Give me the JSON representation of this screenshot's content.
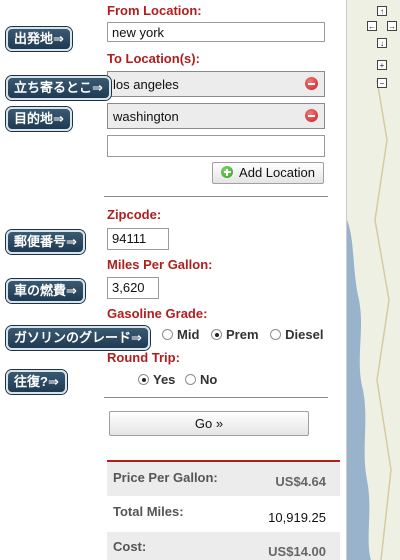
{
  "form": {
    "from_label": "From Location:",
    "from_value": "new york",
    "to_label": "To Location(s):",
    "to_values": [
      "los angeles",
      "washington"
    ],
    "add_location_label": "Add Location",
    "zip_label": "Zipcode:",
    "zip_value": "94111",
    "mpg_label": "Miles Per Gallon:",
    "mpg_value": "3,620",
    "grade_label": "Gasoline Grade:",
    "grade_options": [
      "Mid",
      "Prem",
      "Diesel"
    ],
    "grade_selected": "Prem",
    "round_trip_label": "Round Trip:",
    "round_trip_options": [
      "Yes",
      "No"
    ],
    "round_trip_selected": "Yes",
    "go_label": "Go »"
  },
  "results": {
    "price_label": "Price Per Gallon:",
    "price_value": "US$4.64",
    "miles_label": "Total Miles:",
    "miles_value": "10,919.25",
    "cost_label": "Cost:",
    "cost_value": "US$14.00"
  },
  "annotations": {
    "departure": "出発地⇒",
    "stopover": "立ち寄るとこ⇒",
    "destination": "目的地⇒",
    "postal_code": "郵便番号⇒",
    "fuel_economy": "車の燃費⇒",
    "gasoline_grade": "ガソリンのグレード⇒",
    "round_trip": "往復?⇒"
  },
  "map": {
    "nav_up": "↑",
    "nav_left": "←",
    "nav_right": "→",
    "nav_down": "↓",
    "zoom_in": "+",
    "zoom_out": "−",
    "land_color": "#eef0e4",
    "water_color": "#99b3cc"
  }
}
